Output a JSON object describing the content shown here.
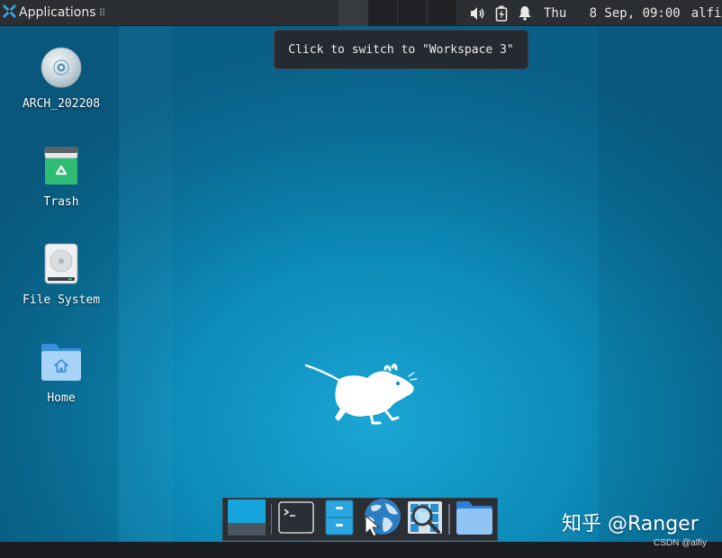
{
  "panel": {
    "applications_label": "Applications",
    "drag_handle": "⠿",
    "clock": "Thu   8 Sep, 09:00",
    "user": "alfiy",
    "workspace_count": 4
  },
  "tooltip": {
    "text": "Click to switch to \"Workspace 3\""
  },
  "desktop": {
    "icons": [
      {
        "name": "ARCH_202208",
        "icon": "disc-icon"
      },
      {
        "name": "Trash",
        "icon": "trash-icon"
      },
      {
        "name": "File System",
        "icon": "drive-icon"
      },
      {
        "name": "Home",
        "icon": "home-folder-icon"
      }
    ]
  },
  "dock": {
    "items": [
      {
        "id": "show-desktop",
        "icon": "show-desktop-icon"
      },
      {
        "id": "terminal",
        "icon": "terminal-icon"
      },
      {
        "id": "file-manager",
        "icon": "file-cabinet-icon"
      },
      {
        "id": "web-browser",
        "icon": "globe-icon"
      },
      {
        "id": "app-finder",
        "icon": "magnifier-icon"
      },
      {
        "id": "folder",
        "icon": "folder-icon"
      }
    ]
  },
  "watermark": {
    "main": "知乎 @Ranger",
    "sub": "CSDN @alfiy"
  },
  "colors": {
    "panel_bg": "#2b2e33",
    "desktop_accent": "#0d8ab8",
    "tooltip_bg": "#252a30"
  }
}
